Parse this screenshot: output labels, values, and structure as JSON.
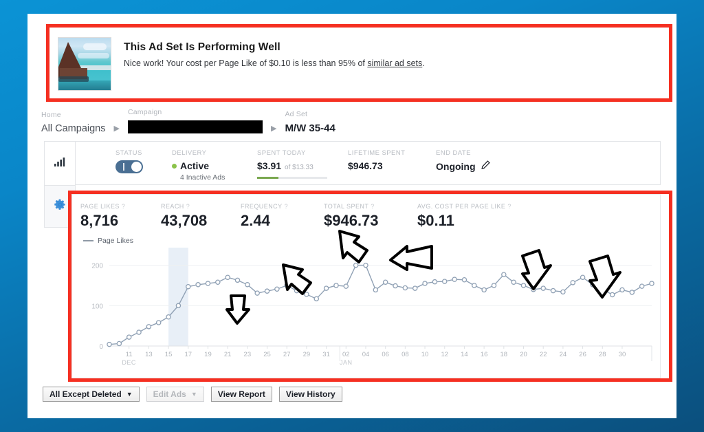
{
  "banner": {
    "title": "This Ad Set Is Performing Well",
    "text_before": "Nice work! Your cost per Page Like of $0.10 is less than 95% of ",
    "link": "similar ad sets",
    "text_after": ".",
    "thumb_alt": "beach-resort-thumbnail"
  },
  "breadcrumb": {
    "home_label": "Home",
    "home_value": "All Campaigns",
    "campaign_label": "Campaign",
    "campaign_value": "",
    "adset_label": "Ad Set",
    "adset_value": "M/W 35-44",
    "separator": "▶"
  },
  "status_bar": {
    "status_label": "STATUS",
    "status_on": true,
    "delivery_label": "DELIVERY",
    "delivery_value": "Active",
    "delivery_sub": "4 Inactive Ads",
    "delivery_dot_color": "#8bc34a",
    "spent_today_label": "SPENT TODAY",
    "spent_today_value": "$3.91",
    "spent_today_of": "of $13.33",
    "spent_progress_pct": 30,
    "lifetime_label": "LIFETIME SPENT",
    "lifetime_value": "$946.73",
    "end_date_label": "END DATE",
    "end_date_value": "Ongoing",
    "edit_icon": "pencil-icon"
  },
  "metrics": [
    {
      "label": "PAGE LIKES",
      "value": "8,716",
      "help": "?"
    },
    {
      "label": "REACH",
      "value": "43,708",
      "help": "?"
    },
    {
      "label": "FREQUENCY",
      "value": "2.44",
      "help": "?"
    },
    {
      "label": "TOTAL SPENT",
      "value": "$946.73",
      "help": "?"
    },
    {
      "label": "AVG. COST PER PAGE LIKE",
      "value": "$0.11",
      "help": "?"
    }
  ],
  "legend": {
    "label": "Page Likes",
    "color": "#8f99a6"
  },
  "buttons": {
    "filter": "All Except Deleted",
    "filter_caret": "▼",
    "edit_ads": "Edit Ads",
    "edit_ads_caret": "▼",
    "edit_ads_disabled": true,
    "view_report": "View Report",
    "view_history": "View History"
  },
  "rail": {
    "chart_icon": "bar-chart-icon",
    "settings_icon": "gear-icon"
  },
  "annotations": {
    "box_color": "#f52f21",
    "arrow_color": "#000000",
    "arrow_count": 5,
    "arrows": [
      {
        "name": "arrow-dec21",
        "points_to": "Dec 21 peak"
      },
      {
        "name": "arrow-dec27",
        "points_to": "Dec 27 point"
      },
      {
        "name": "arrow-jan03-left",
        "points_to": "Jan 03-04 peak"
      },
      {
        "name": "arrow-jan04-right",
        "points_to": "Jan 03-04 peak"
      },
      {
        "name": "arrow-jan18",
        "points_to": "Jan 18 peak"
      },
      {
        "name": "arrow-jan26",
        "points_to": "Jan 26 peak"
      }
    ]
  },
  "chart_data": {
    "type": "line",
    "title": "",
    "xlabel": "",
    "ylabel": "",
    "ylim": [
      0,
      230
    ],
    "yticks": [
      0,
      100,
      200
    ],
    "ytick_labels": [
      "0",
      "100",
      "200"
    ],
    "grid": true,
    "legend": [
      "Page Likes"
    ],
    "legend_position": "top-left",
    "line_color": "#8fa0b4",
    "marker": "open-circle",
    "highlight_band": {
      "from_index": 6,
      "to_index": 8,
      "color": "#dce7f3"
    },
    "month_labels": [
      {
        "label": "DEC",
        "at_index": 2
      },
      {
        "label": "JAN",
        "at_index": 24
      }
    ],
    "x": [
      "09",
      "10",
      "11",
      "12",
      "13",
      "14",
      "15",
      "16",
      "17",
      "18",
      "19",
      "20",
      "21",
      "22",
      "23",
      "24",
      "25",
      "26",
      "27",
      "28",
      "29",
      "30",
      "31",
      "01",
      "02",
      "03",
      "04",
      "05",
      "06",
      "07",
      "08",
      "09",
      "10",
      "11",
      "12",
      "13",
      "14",
      "15",
      "16",
      "17",
      "18",
      "19",
      "20",
      "21",
      "22",
      "23",
      "24",
      "25",
      "26",
      "27",
      "28",
      "29",
      "30",
      "31",
      "01"
    ],
    "xtick_labels": [
      "11",
      "13",
      "15",
      "17",
      "19",
      "21",
      "23",
      "25",
      "27",
      "29",
      "31",
      "02",
      "04",
      "06",
      "08",
      "10",
      "12",
      "14",
      "16",
      "18",
      "20",
      "22",
      "24",
      "26",
      "28",
      "30"
    ],
    "values": [
      4,
      6,
      22,
      34,
      48,
      58,
      72,
      100,
      147,
      152,
      155,
      158,
      170,
      163,
      152,
      131,
      136,
      141,
      150,
      137,
      128,
      117,
      143,
      150,
      148,
      200,
      200,
      139,
      158,
      149,
      144,
      143,
      155,
      159,
      160,
      165,
      164,
      150,
      139,
      150,
      177,
      158,
      150,
      140,
      143,
      137,
      134,
      157,
      170,
      152,
      141,
      127,
      139,
      133,
      148,
      155
    ],
    "series": [
      {
        "name": "Page Likes",
        "values": [
          4,
          6,
          22,
          34,
          48,
          58,
          72,
          100,
          147,
          152,
          155,
          158,
          170,
          163,
          152,
          131,
          136,
          141,
          150,
          137,
          128,
          117,
          143,
          150,
          148,
          200,
          200,
          139,
          158,
          149,
          144,
          143,
          155,
          159,
          160,
          165,
          164,
          150,
          139,
          150,
          177,
          158,
          150,
          140,
          143,
          137,
          134,
          157,
          170,
          152,
          141,
          127,
          139,
          133,
          148,
          155
        ]
      }
    ]
  }
}
